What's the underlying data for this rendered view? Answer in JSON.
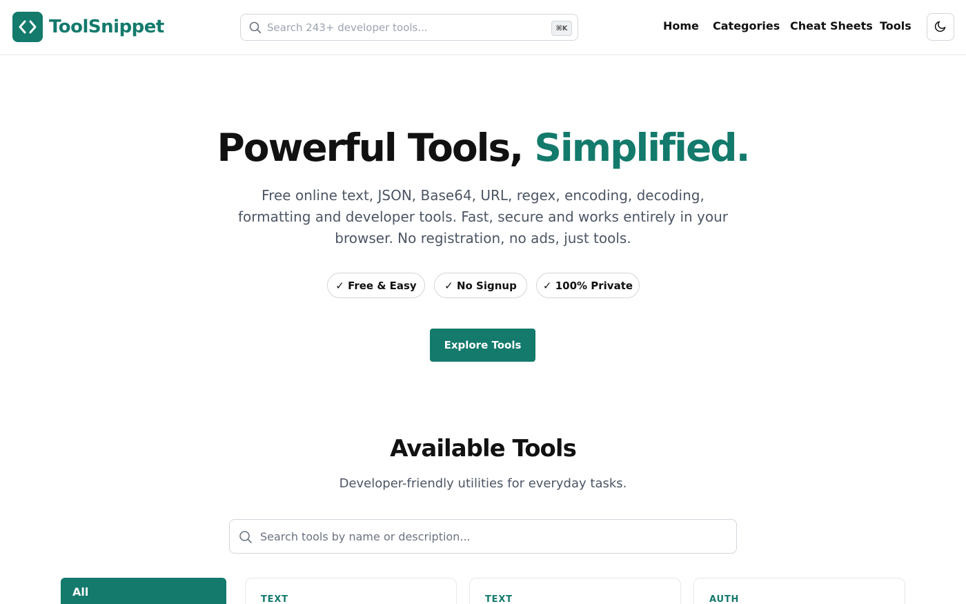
{
  "brand": {
    "name": "ToolSnippet",
    "color": "#137a6c"
  },
  "header": {
    "search_placeholder": "Search 243+ developer tools...",
    "shortcut": "⌘K",
    "nav": [
      "Home",
      "Categories",
      "Cheat Sheets",
      "Tools"
    ],
    "theme_icon": "moon-icon"
  },
  "hero": {
    "title_main": "Powerful Tools,",
    "title_accent": "Simplified.",
    "description": "Free online text, JSON, Base64, URL, regex, encoding, decoding, formatting and developer tools. Fast, secure and works entirely in your browser. No registration, no ads, just tools.",
    "badges": [
      "✓ Free & Easy",
      "✓ No Signup",
      "✓ 100% Private"
    ],
    "cta": "Explore Tools"
  },
  "tools_section": {
    "title": "Available Tools",
    "subtitle": "Developer-friendly utilities for everyday tasks.",
    "search_placeholder": "Search tools by name or description...",
    "active_category": "All",
    "cards": [
      {
        "category": "TEXT"
      },
      {
        "category": "TEXT"
      },
      {
        "category": "AUTH"
      }
    ]
  }
}
